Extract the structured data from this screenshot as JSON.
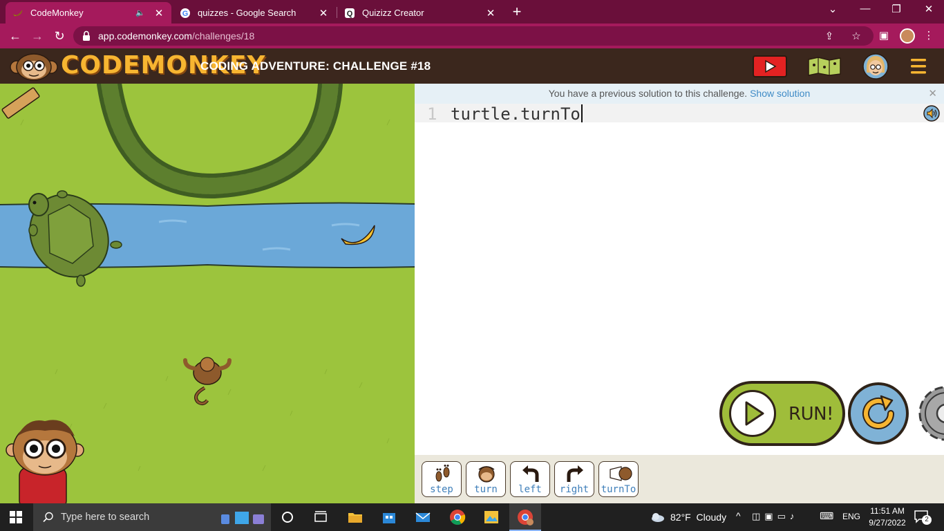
{
  "browser": {
    "tabs": [
      {
        "title": "CodeMonkey",
        "active": true
      },
      {
        "title": "quizzes - Google Search",
        "active": false
      },
      {
        "title": "Quizizz Creator",
        "active": false
      }
    ],
    "address": {
      "host": "app.codemonkey.com",
      "path": "/challenges/18"
    }
  },
  "header": {
    "logo_text": "CODEMONKEY",
    "challenge_title": "CODING ADVENTURE: CHALLENGE #18"
  },
  "editor": {
    "notice_text": "You have a previous solution to this challenge.",
    "notice_link": "Show solution",
    "line_number": "1",
    "code": "turtle.turnTo",
    "run_label": "RUN!"
  },
  "palette": [
    {
      "label": "step",
      "icon": "footprints-icon"
    },
    {
      "label": "turn",
      "icon": "monkey-turn-icon"
    },
    {
      "label": "left",
      "icon": "left-arrow-icon"
    },
    {
      "label": "right",
      "icon": "right-arrow-icon"
    },
    {
      "label": "turnTo",
      "icon": "turnto-icon"
    }
  ],
  "taskbar": {
    "search_placeholder": "Type here to search",
    "weather": "82°F  Cloudy",
    "language": "ENG",
    "time": "11:51 AM",
    "date": "9/27/2022",
    "notifications": "2"
  },
  "colors": {
    "tab_strip": "#6a0f3a",
    "toolbar": "#a51a5c",
    "app_header": "#3b271d",
    "logo": "#f7b531",
    "grass": "#9cc43d",
    "water": "#6ba8d8",
    "run_button": "#9fbd3a",
    "link": "#3f8bc6"
  }
}
